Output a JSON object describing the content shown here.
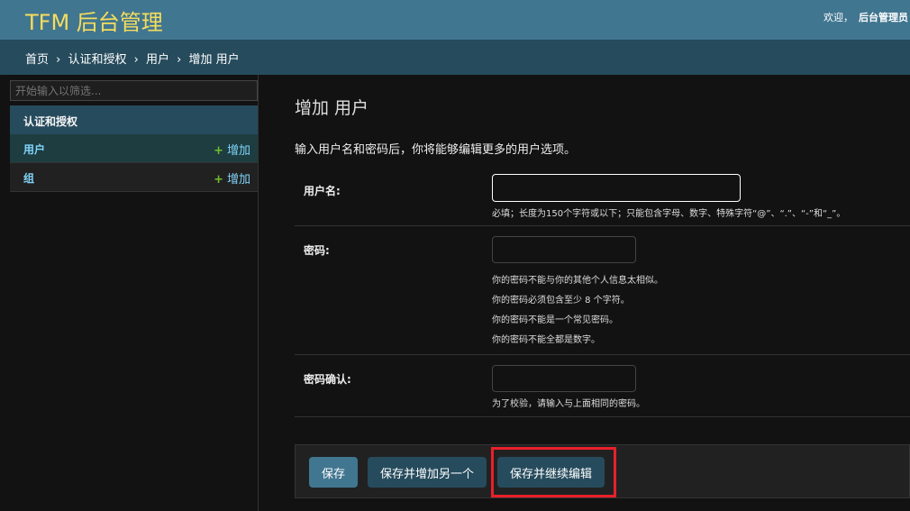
{
  "header": {
    "brand": "TFM 后台管理",
    "welcome": "欢迎，",
    "username": "后台管理员"
  },
  "breadcrumbs": [
    "首页",
    "认证和授权",
    "用户",
    "增加 用户"
  ],
  "breadcrumb_separator": "›",
  "sidebar": {
    "filter_placeholder": "开始输入以筛选...",
    "module": "认证和授权",
    "items": [
      {
        "label": "用户",
        "add": "增加"
      },
      {
        "label": "组",
        "add": "增加"
      }
    ]
  },
  "main": {
    "title": "增加 用户",
    "intro": "输入用户名和密码后，你将能够编辑更多的用户选项。",
    "fields": {
      "username": {
        "label": "用户名:",
        "value": "",
        "help": "必填；长度为150个字符或以下；只能包含字母、数字、特殊字符“@”、“.”、“-”和“_”。"
      },
      "password": {
        "label": "密码:",
        "value": "",
        "help": [
          "你的密码不能与你的其他个人信息太相似。",
          "你的密码必须包含至少 8 个字符。",
          "你的密码不能是一个常见密码。",
          "你的密码不能全都是数字。"
        ]
      },
      "password_confirm": {
        "label": "密码确认:",
        "value": "",
        "help": "为了校验，请输入与上面相同的密码。"
      }
    },
    "buttons": {
      "save": "保存",
      "save_add": "保存并增加另一个",
      "save_continue": "保存并继续编辑"
    }
  },
  "colors": {
    "header": "#417690",
    "brand": "#f5dd5d",
    "breadcrumbs": "#264b5d",
    "link": "#81d4fa",
    "add_plus": "#70bf2b",
    "highlight": "#e8202a"
  },
  "icons": {
    "add": "plus-icon"
  }
}
